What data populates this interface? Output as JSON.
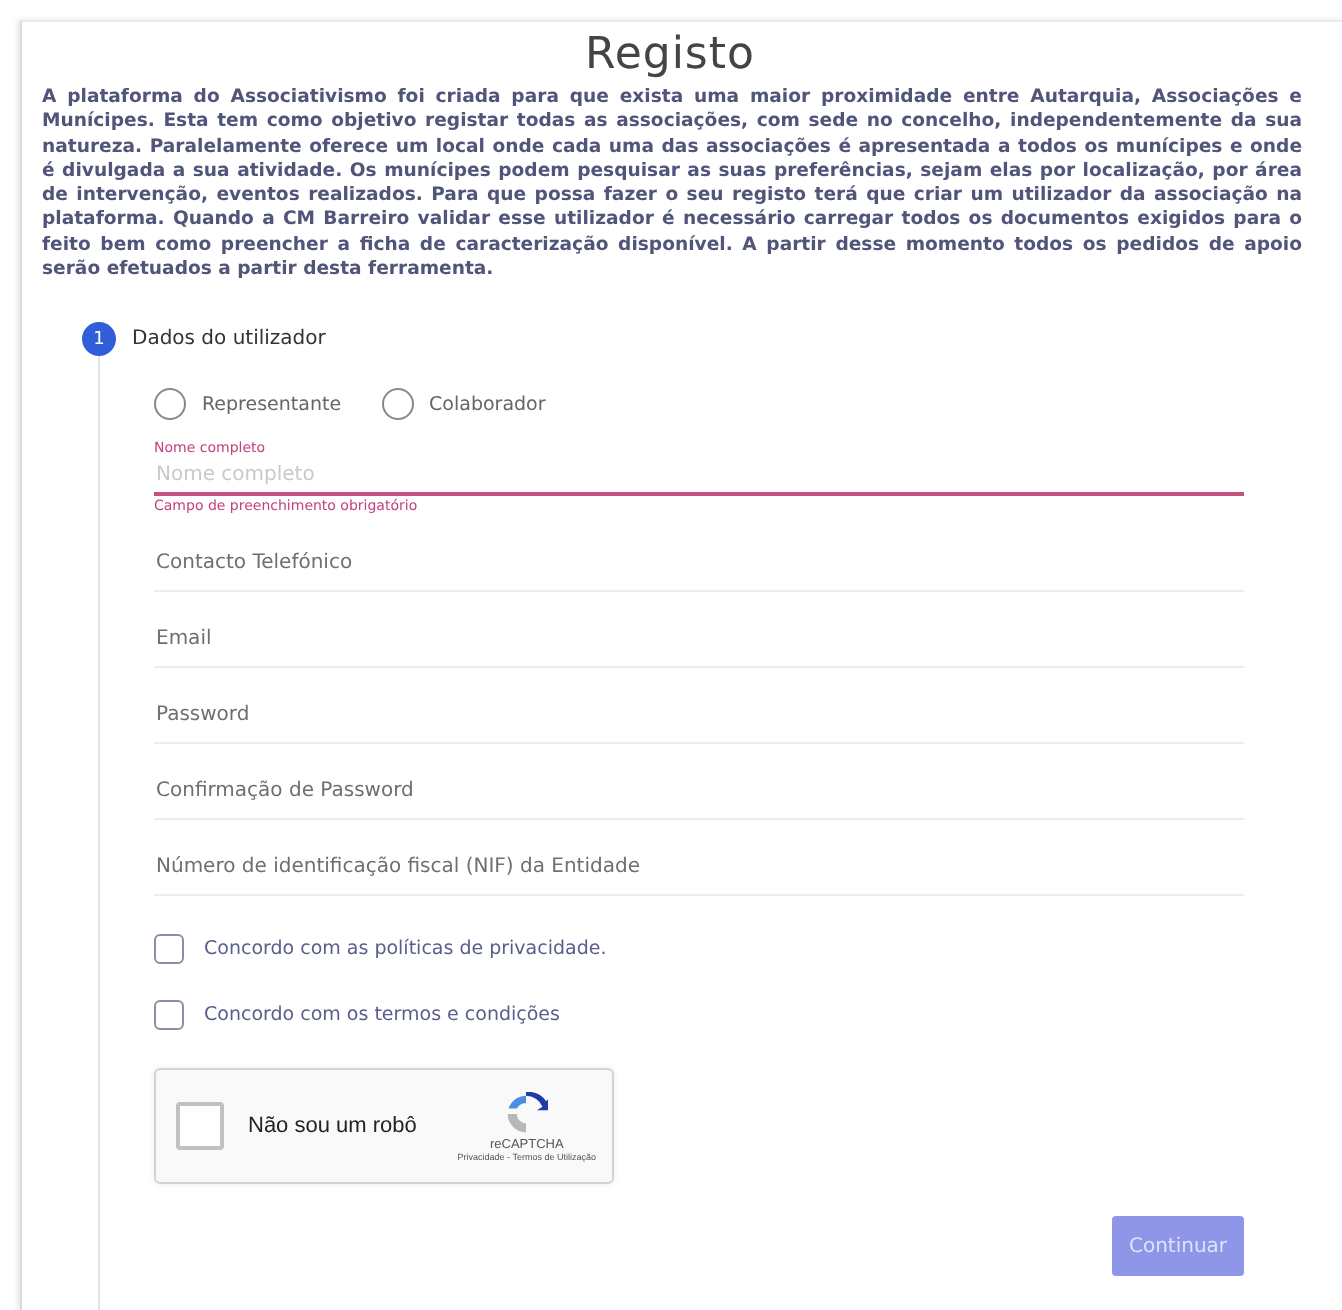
{
  "title": "Registo",
  "intro": "A plataforma do Associativismo foi criada para que exista uma maior proximidade entre Autarquia, Associações e Munícipes. Esta tem como objetivo registar todas as associações, com sede no concelho, independentemente da sua natureza. Paralelamente oferece um local onde cada uma das associações é apresentada a todos os munícipes e onde é divulgada a sua atividade. Os munícipes podem pesquisar as suas preferências, sejam elas por localização, por área de intervenção, eventos realizados. Para que possa fazer o seu registo terá que criar um utilizador da associação na plataforma. Quando a CM Barreiro validar esse utilizador é necessário carregar todos os documentos exigidos para o feito bem como preencher a ficha de caracterização disponível. A partir desse momento todos os pedidos de apoio serão efetuados a partir desta ferramenta.",
  "step": {
    "number": "1",
    "label": "Dados do utilizador"
  },
  "radios": [
    {
      "label": "Representante",
      "selected": false
    },
    {
      "label": "Colaborador",
      "selected": false
    }
  ],
  "fields": [
    {
      "label": "Nome completo",
      "placeholder": "Nome completo",
      "invalid": true,
      "error": "Campo de preenchimento obrigatório"
    },
    {
      "placeholder": "Contacto Telefónico",
      "invalid": false
    },
    {
      "placeholder": "Email",
      "invalid": false
    },
    {
      "placeholder": "Password",
      "invalid": false
    },
    {
      "placeholder": "Confirmação de Password",
      "invalid": false
    },
    {
      "placeholder": "Número de identificação fiscal (NIF) da Entidade",
      "invalid": false
    }
  ],
  "checkboxes": [
    {
      "label": "Concordo com as políticas de privacidade.",
      "checked": false
    },
    {
      "label": "Concordo com os termos e condições",
      "checked": false
    }
  ],
  "captcha": {
    "label": "Não sou um robô",
    "checked": false,
    "brand": "reCAPTCHA",
    "links": "Privacidade - Termos de Utilização"
  },
  "button": {
    "label": "Continuar",
    "disabled": true
  }
}
